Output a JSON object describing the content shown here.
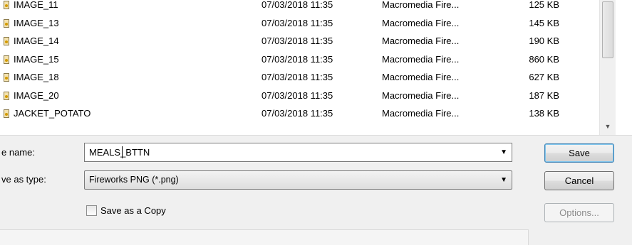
{
  "files": [
    {
      "name": "IMAGE_11",
      "date": "07/03/2018 11:35",
      "type": "Macromedia Fire...",
      "size": "125 KB",
      "icon": "fireworks-file-icon"
    },
    {
      "name": "IMAGE_13",
      "date": "07/03/2018 11:35",
      "type": "Macromedia Fire...",
      "size": "145 KB",
      "icon": "fireworks-file-icon"
    },
    {
      "name": "IMAGE_14",
      "date": "07/03/2018 11:35",
      "type": "Macromedia Fire...",
      "size": "190 KB",
      "icon": "fireworks-file-icon"
    },
    {
      "name": "IMAGE_15",
      "date": "07/03/2018 11:35",
      "type": "Macromedia Fire...",
      "size": "860 KB",
      "icon": "fireworks-file-icon"
    },
    {
      "name": "IMAGE_18",
      "date": "07/03/2018 11:35",
      "type": "Macromedia Fire...",
      "size": "627 KB",
      "icon": "fireworks-file-icon"
    },
    {
      "name": "IMAGE_20",
      "date": "07/03/2018 11:35",
      "type": "Macromedia Fire...",
      "size": "187 KB",
      "icon": "fireworks-file-icon"
    },
    {
      "name": "JACKET_POTATO",
      "date": "07/03/2018 11:35",
      "type": "Macromedia Fire...",
      "size": "138 KB",
      "icon": "fireworks-file-icon"
    }
  ],
  "form": {
    "file_name_label": "e name:",
    "file_name_value": "MEALS_BTTN",
    "save_type_label": "ve as type:",
    "save_type_value": "Fireworks PNG (*.png)",
    "save_copy_label": "Save as a Copy",
    "save_copy_checked": false
  },
  "buttons": {
    "save": "Save",
    "cancel": "Cancel",
    "options": "Options..."
  },
  "icons": {
    "dropdown": "▼",
    "scroll_down": "▼"
  },
  "colors": {
    "save_button_border": "#3c7fb1",
    "disabled_text": "#8d8d8d"
  }
}
